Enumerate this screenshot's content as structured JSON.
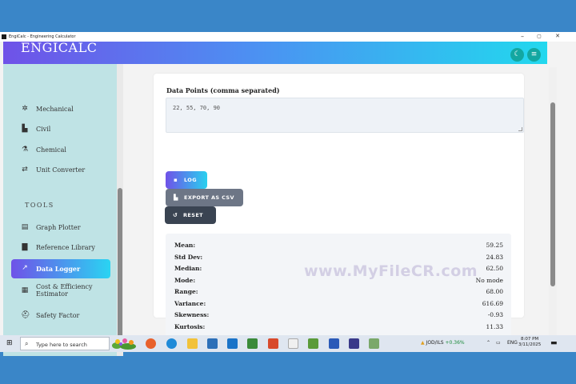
{
  "window": {
    "title": "EngiCalc - Engineering Calculator",
    "controls": {
      "minimize": "–",
      "maximize": "▢",
      "close": "✕"
    }
  },
  "header": {
    "brand": "ENGICALC",
    "theme_icon": "moon-icon",
    "menu_icon": "menu-icon"
  },
  "sidebar": {
    "items": [
      {
        "label": "Mechanical",
        "icon": "gear-icon",
        "glyph": "✲"
      },
      {
        "label": "Civil",
        "icon": "building-icon",
        "glyph": "▙"
      },
      {
        "label": "Chemical",
        "icon": "flask-icon",
        "glyph": "⚗"
      },
      {
        "label": "Unit Converter",
        "icon": "exchange-icon",
        "glyph": "⇄"
      }
    ],
    "tools_heading": "TOOLS",
    "tools": [
      {
        "label": "Graph Plotter",
        "icon": "chart-icon",
        "glyph": "▤"
      },
      {
        "label": "Reference Library",
        "icon": "book-icon",
        "glyph": "▇"
      },
      {
        "label": "Data Logger",
        "icon": "line-chart-icon",
        "glyph": "↗",
        "active": true
      },
      {
        "label": "Cost & Efficiency Estimator",
        "icon": "calculator-icon",
        "glyph": "▦"
      },
      {
        "label": "Safety Factor",
        "icon": "hardhat-icon",
        "glyph": "⛑"
      }
    ]
  },
  "main": {
    "data_points_label": "Data Points (comma separated)",
    "data_points_value": "22, 55, 70, 90",
    "buttons": {
      "log": {
        "label": "LOG",
        "glyph": "▪"
      },
      "export": {
        "label": "EXPORT AS CSV",
        "glyph": "▙"
      },
      "reset": {
        "label": "RESET",
        "glyph": "↺"
      }
    },
    "stats": [
      {
        "key": "Mean:",
        "value": "59.25"
      },
      {
        "key": "Std Dev:",
        "value": "24.83"
      },
      {
        "key": "Median:",
        "value": "62.50"
      },
      {
        "key": "Mode:",
        "value": "No mode"
      },
      {
        "key": "Range:",
        "value": "68.00"
      },
      {
        "key": "Variance:",
        "value": "616.69"
      },
      {
        "key": "Skewness:",
        "value": "-0.93"
      },
      {
        "key": "Kurtosis:",
        "value": "11.33"
      }
    ]
  },
  "watermark": "www.MyFileCR.com",
  "taskbar": {
    "search_placeholder": "Type here to search",
    "ticker_symbol": "JOD/ILS",
    "ticker_change": "+0.36%",
    "language": "ENG",
    "time": "8:07 PM",
    "date": "3/11/2025"
  }
}
